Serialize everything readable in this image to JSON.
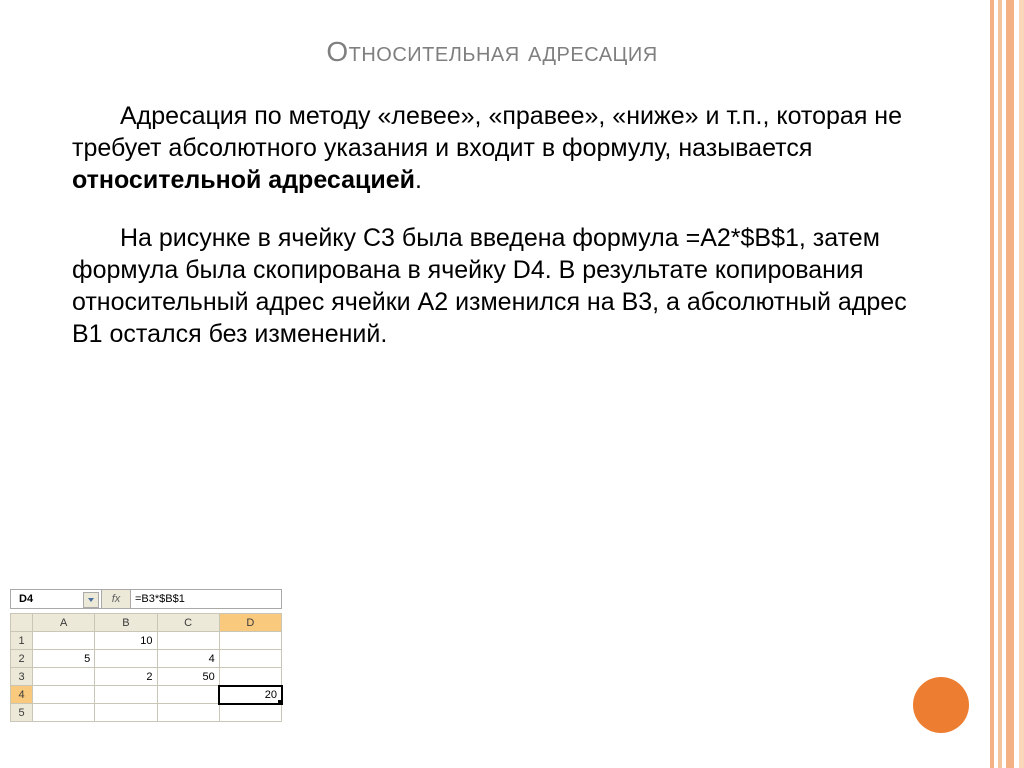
{
  "title": "Относительная адресация",
  "para1a": "Адресация по методу «левее», «правее», «ниже» и т.п., которая не требует абсолютного указания и входит в формулу, называется ",
  "para1b": "относительной адресацией",
  "para1c": ".",
  "para2": "На рисунке в ячейку С3 была введена формула =A2*$B$1, затем формула была скопирована в ячейку D4. В результате копирования относительный адрес ячейки А2 изменился на В3, а абсолютный адрес В1 остался без изменений.",
  "sheet": {
    "name_box": "D4",
    "fx_label": "fx",
    "formula": "=B3*$B$1",
    "cols": [
      "A",
      "B",
      "C",
      "D"
    ],
    "rows": [
      "1",
      "2",
      "3",
      "4",
      "5"
    ],
    "selected_col_index": 3,
    "selected_row_index": 3,
    "cells": {
      "B1": "10",
      "A2": "5",
      "C2": "4",
      "B3": "2",
      "C3": "50",
      "D4": "20"
    }
  },
  "chart_data": {
    "type": "table",
    "columns": [
      "A",
      "B",
      "C",
      "D"
    ],
    "rows": [
      {
        "row": 1,
        "A": "",
        "B": 10,
        "C": "",
        "D": ""
      },
      {
        "row": 2,
        "A": 5,
        "B": "",
        "C": 4,
        "D": ""
      },
      {
        "row": 3,
        "A": "",
        "B": 2,
        "C": 50,
        "D": ""
      },
      {
        "row": 4,
        "A": "",
        "B": "",
        "C": "",
        "D": 20
      },
      {
        "row": 5,
        "A": "",
        "B": "",
        "C": "",
        "D": ""
      }
    ],
    "active_cell": "D4",
    "active_formula": "=B3*$B$1"
  }
}
